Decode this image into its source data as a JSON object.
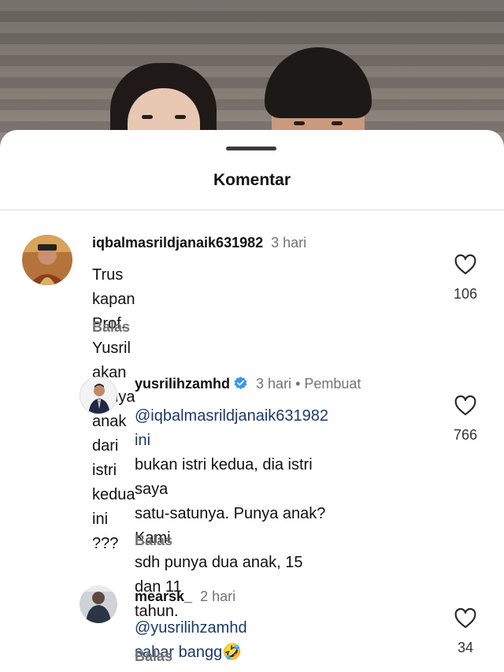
{
  "sheet": {
    "title": "Komentar"
  },
  "comments": [
    {
      "username": "iqbalmasrildjanaik631982",
      "time": "3 hari",
      "text_lines": [
        "Trus kapan Prof. Yusril akan punya",
        "anak dari istri kedua ini ???"
      ],
      "reply_label": "Balas",
      "likes": "106"
    },
    {
      "username": "yusrilihzamhd",
      "time": "3 hari",
      "tag": "• Pembuat",
      "text_lines": [
        "@iqbalmasrildjanaik631982 ini",
        "bukan istri kedua, dia istri saya",
        "satu-satunya. Punya anak? Kami",
        "sdh punya dua anak, 15 dan 11",
        "tahun."
      ],
      "reply_label": "Balas",
      "likes": "766"
    },
    {
      "username": "mearsk_",
      "time": "2 hari",
      "text_lines": [
        "@yusrilihzamhd sabar bangg🤣"
      ],
      "reply_label": "Balas",
      "likes": "34"
    }
  ],
  "colors": {
    "verified": "#3897f0",
    "mention": "#1a3a6b",
    "muted": "#737373"
  }
}
